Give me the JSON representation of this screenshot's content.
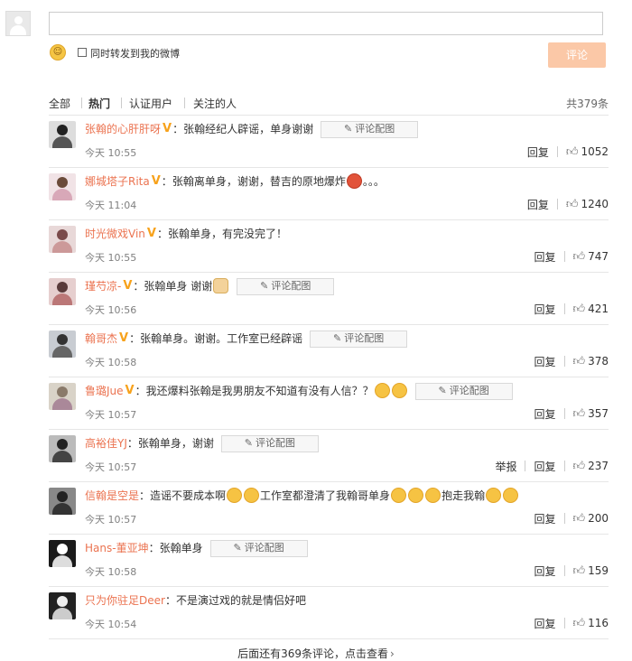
{
  "composer": {
    "emoji_glyph": "☺",
    "repost_label": "同时转发到我的微博",
    "submit_label": "评论"
  },
  "filters": {
    "tabs": [
      "全部",
      "热门",
      "认证用户",
      "关注的人"
    ],
    "active_tab": "热门",
    "total": "共379条"
  },
  "comments": [
    {
      "user": "张翰的心肝肝呀",
      "vip": "V",
      "sep": "：",
      "text": "张翰经纪人辟谣，单身谢谢",
      "has_pic_btn": true,
      "time": "今天 10:55",
      "report": "",
      "reply": "回复",
      "likes": "1052",
      "avatar_head": "#222",
      "avatar_body": "#555",
      "avatar_bg": "#ddd"
    },
    {
      "user": "娜城塔子Rita",
      "vip": "V",
      "sep": "：",
      "text": "张翰离单身，谢谢，替吉的原地爆炸",
      "has_pic_btn": false,
      "tail": "。。。",
      "emoji_after": "red",
      "time": "今天 11:04",
      "report": "",
      "reply": "回复",
      "likes": "1240",
      "avatar_head": "#6b4b3a",
      "avatar_body": "#d8a8b8",
      "avatar_bg": "#f1e3e6"
    },
    {
      "user": "时光微戏Vin",
      "vip": "V",
      "sep": "：",
      "text": "张翰单身，有完没完了！",
      "has_pic_btn": false,
      "time": "今天 10:55",
      "report": "",
      "reply": "回复",
      "likes": "747",
      "avatar_head": "#7a4a4a",
      "avatar_body": "#c99",
      "avatar_bg": "#e8d8d8"
    },
    {
      "user": "瑾芍凉-",
      "vip": "V",
      "sep": "：",
      "text": "张翰单身 谢谢",
      "has_pic_btn": true,
      "emoji_after": "hand",
      "time": "今天 10:56",
      "report": "",
      "reply": "回复",
      "likes": "421",
      "avatar_head": "#5a3b3b",
      "avatar_body": "#b77",
      "avatar_bg": "#e6cfcf"
    },
    {
      "user": "翰哥杰",
      "vip": "V",
      "sep": "：",
      "text": "张翰单身。谢谢。工作室已经辟谣",
      "has_pic_btn": true,
      "time": "今天 10:58",
      "report": "",
      "reply": "回复",
      "likes": "378",
      "avatar_head": "#333",
      "avatar_body": "#666",
      "avatar_bg": "#c8ccd2"
    },
    {
      "user": "鲁璐Jue",
      "vip": "V",
      "sep": "：",
      "text": "我还爆料张翰是我男朋友不知道有没有人信？？",
      "has_pic_btn": true,
      "emoji_after": "double",
      "time": "今天 10:57",
      "report": "",
      "reply": "回复",
      "likes": "357",
      "avatar_head": "#8a7a6a",
      "avatar_body": "#a89",
      "avatar_bg": "#d9d3c8"
    },
    {
      "user": "高裕佳YJ",
      "vip": "",
      "sep": "：",
      "text": "张翰单身，谢谢",
      "has_pic_btn": true,
      "time": "今天 10:57",
      "report": "举报",
      "reply": "回复",
      "likes": "237",
      "avatar_head": "#222",
      "avatar_body": "#444",
      "avatar_bg": "#bbb"
    },
    {
      "user": "信翰是空是",
      "vip": "",
      "sep": "：",
      "text": "造谣不要成本啊",
      "has_pic_btn": false,
      "emoji_mid": "工作室都澄清了我翰哥单身",
      "tail2": "抱走我翰",
      "time": "今天 10:57",
      "report": "",
      "reply": "回复",
      "likes": "200",
      "avatar_head": "#222",
      "avatar_body": "#333",
      "avatar_bg": "#888"
    },
    {
      "user": "Hans-董亚坤",
      "vip": "",
      "sep": "：",
      "text": "张翰单身",
      "has_pic_btn": true,
      "time": "今天 10:58",
      "report": "",
      "reply": "回复",
      "likes": "159",
      "avatar_head": "#fff",
      "avatar_body": "#ddd",
      "avatar_bg": "#1a1a1a"
    },
    {
      "user": "只为你驻足Deer",
      "vip": "",
      "sep": "：",
      "text": "不是演过戏的就是情侣好吧",
      "has_pic_btn": false,
      "time": "今天 10:54",
      "report": "",
      "reply": "回复",
      "likes": "116",
      "avatar_head": "#eee",
      "avatar_body": "#ccc",
      "avatar_bg": "#222"
    }
  ],
  "pic_btn_label": "评论配图",
  "more": {
    "label": "后面还有369条评论，点击查看",
    "chevron": "›"
  }
}
